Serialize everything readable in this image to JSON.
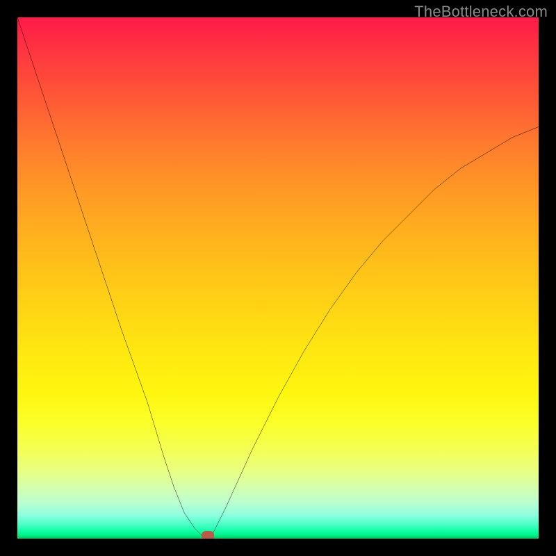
{
  "watermark": {
    "text": "TheBottleneck.com"
  },
  "chart_data": {
    "type": "line",
    "title": "",
    "xlabel": "",
    "ylabel": "",
    "xlim": [
      0,
      100
    ],
    "ylim": [
      0,
      100
    ],
    "grid": false,
    "legend": false,
    "background_gradient": {
      "orientation": "vertical",
      "stops": [
        {
          "pos": 0,
          "color": "#ff1a4a"
        },
        {
          "pos": 50,
          "color": "#ffc915"
        },
        {
          "pos": 80,
          "color": "#f6ff40"
        },
        {
          "pos": 100,
          "color": "#00c85f"
        }
      ]
    },
    "series": [
      {
        "name": "bottleneck-curve",
        "color": "#000000",
        "x": [
          0,
          5,
          10,
          15,
          20,
          25,
          28,
          30,
          32,
          34,
          36,
          37,
          40,
          45,
          50,
          55,
          60,
          65,
          70,
          75,
          80,
          85,
          90,
          95,
          100
        ],
        "y": [
          100,
          85,
          70,
          55,
          40,
          26,
          16,
          10,
          5,
          2,
          0,
          0,
          6,
          17,
          27,
          36,
          44,
          51,
          57,
          62,
          67,
          71,
          74,
          77,
          79
        ]
      }
    ],
    "marker": {
      "name": "optimal-point",
      "x": 36.5,
      "y": 0.5,
      "color": "#b95a4a"
    }
  }
}
